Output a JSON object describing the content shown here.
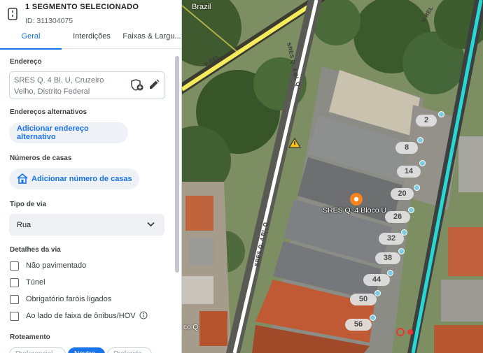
{
  "segment": {
    "title": "1 SEGMENTO SELECIONADO",
    "id_text": "ID: 311304075"
  },
  "tabs": [
    {
      "label": "Geral",
      "active": true
    },
    {
      "label": "Interdições",
      "active": false
    },
    {
      "label": "Faixas & Largu...",
      "active": false
    }
  ],
  "form": {
    "address_label": "Endereço",
    "address_value": "SRES Q. 4 Bl. U, Cruzeiro Velho, Distrito Federal",
    "alt_address_label": "Endereços alternativos",
    "alt_address_button": "Adicionar endereço alternativo",
    "house_numbers_label": "Números de casas",
    "house_numbers_button": "Adicionar número de casas",
    "road_type_label": "Tipo de via",
    "road_type_value": "Rua",
    "road_details_label": "Detalhes da via",
    "checkboxes": [
      {
        "label": "Não pavimentado",
        "checked": false
      },
      {
        "label": "Túnel",
        "checked": false
      },
      {
        "label": "Obrigatório faróis ligados",
        "checked": false
      },
      {
        "label": "Ao lado de faixa de ônibus/HOV",
        "checked": false
      }
    ],
    "routing_label": "Roteamento",
    "routing_options": [
      "Preferencial",
      "Neutro",
      "Preferida"
    ]
  },
  "icons": {
    "segment": "segment-icon",
    "address_add": "shield-add-icon",
    "address_edit": "pencil-icon",
    "house": "house-icon",
    "dropdown": "chevron-down-icon",
    "info": "info-icon",
    "place": "place-pin-icon",
    "warning": "warning-icon"
  },
  "colors": {
    "accent": "#1a73e8",
    "selected_road": "#26d9d4",
    "main_road": "#f5ec5c",
    "place_pin": "#f5841f"
  },
  "map": {
    "country_label": "Brazil",
    "place_label": "SRES Q. 4 Bloco U",
    "road_labels": [
      "SRES Q. 4 Bl. Q",
      "SRES Q. 4 Bl. Q",
      "V-REL",
      "V-REL"
    ],
    "house_numbers": [
      "2",
      "8",
      "14",
      "20",
      "26",
      "32",
      "38",
      "44",
      "50",
      "56"
    ],
    "fragment_text": "co Q"
  }
}
